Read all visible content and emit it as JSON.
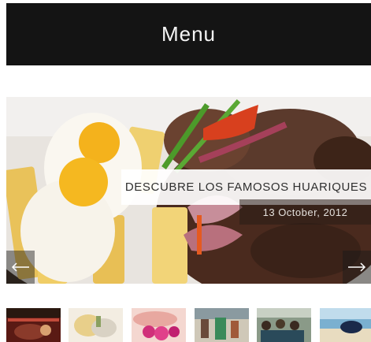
{
  "header": {
    "menu_label": "Menu"
  },
  "slider": {
    "caption": "DESCUBRE LOS FAMOSOS HUARIQUES",
    "date": "13 October, 2012",
    "prev_icon": "arrow-left-icon",
    "next_icon": "arrow-right-icon"
  },
  "thumbnails": [
    {
      "name": "thumbnail-1"
    },
    {
      "name": "thumbnail-2"
    },
    {
      "name": "thumbnail-3"
    },
    {
      "name": "thumbnail-4"
    },
    {
      "name": "thumbnail-5"
    },
    {
      "name": "thumbnail-6"
    }
  ]
}
